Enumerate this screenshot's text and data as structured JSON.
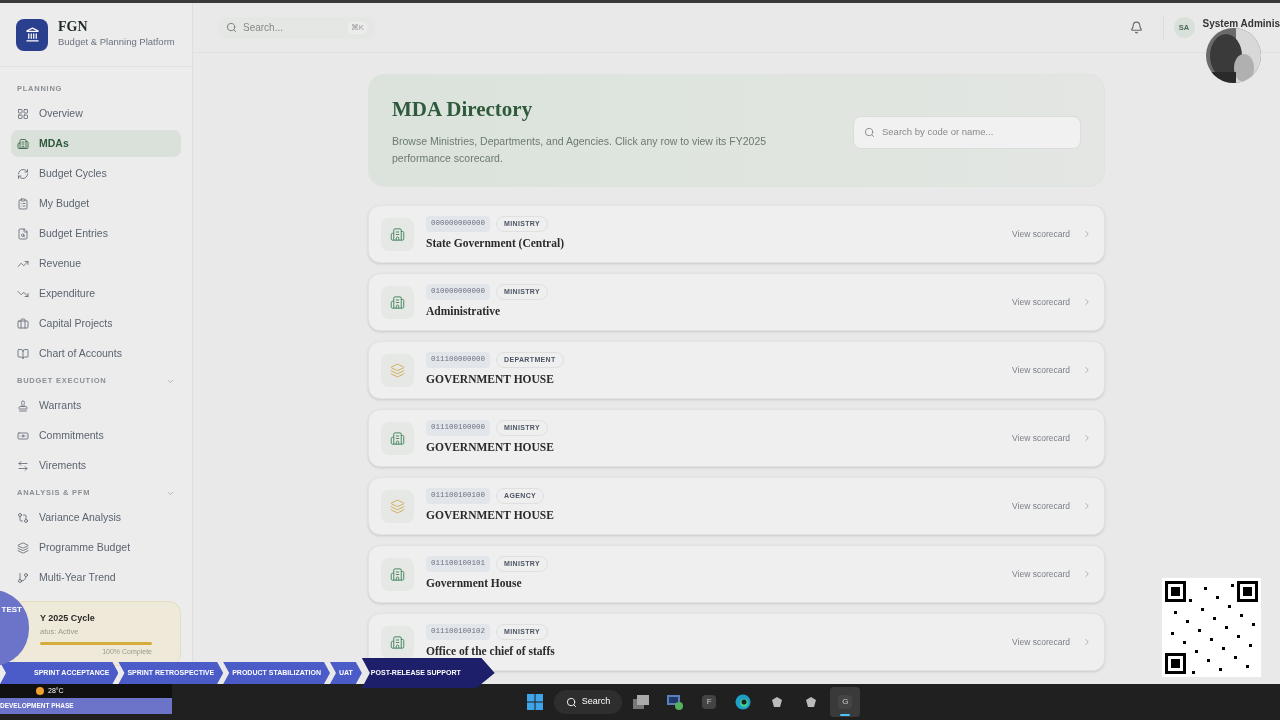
{
  "app": {
    "title": "FGN",
    "subtitle": "Budget & Planning Platform"
  },
  "sidebar": {
    "sections": [
      {
        "label": "PLANNING",
        "collapsible": false,
        "items": [
          {
            "label": "Overview",
            "selected": false
          },
          {
            "label": "MDAs",
            "selected": true
          },
          {
            "label": "Budget Cycles",
            "selected": false
          },
          {
            "label": "My Budget",
            "selected": false
          },
          {
            "label": "Budget Entries",
            "selected": false
          },
          {
            "label": "Revenue",
            "selected": false
          },
          {
            "label": "Expenditure",
            "selected": false
          },
          {
            "label": "Capital Projects",
            "selected": false
          },
          {
            "label": "Chart of Accounts",
            "selected": false
          }
        ]
      },
      {
        "label": "BUDGET EXECUTION",
        "collapsible": true,
        "items": [
          {
            "label": "Warrants",
            "selected": false
          },
          {
            "label": "Commitments",
            "selected": false
          },
          {
            "label": "Virements",
            "selected": false
          }
        ]
      },
      {
        "label": "ANALYSIS & PFM",
        "collapsible": true,
        "items": [
          {
            "label": "Variance Analysis",
            "selected": false
          },
          {
            "label": "Programme Budget",
            "selected": false
          },
          {
            "label": "Multi-Year Trend",
            "selected": false
          }
        ]
      }
    ],
    "cycle_card": {
      "title": "Y 2025 Cycle",
      "status": "atus: Active",
      "level": 1,
      "reading": "100% Complete"
    }
  },
  "header": {
    "search": {
      "placeholder": "Search...",
      "shortcut": "⌘K"
    },
    "user": {
      "initials": "SA",
      "name": "System Adminis"
    }
  },
  "directory": {
    "title": "MDA Directory",
    "description": "Browse Ministries, Departments, and Agencies. Click any row to view its FY2025 performance scorecard.",
    "search": {
      "placeholder": "Search by code or name..."
    },
    "rows": [
      {
        "code": "000000000000",
        "type": "MINISTRY",
        "name": "State Government (Central)",
        "kind": "building",
        "action": "View scorecard"
      },
      {
        "code": "010000000000",
        "type": "MINISTRY",
        "name": "Administrative",
        "kind": "building",
        "action": "View scorecard"
      },
      {
        "code": "011100000000",
        "type": "DEPARTMENT",
        "name": "GOVERNMENT HOUSE",
        "kind": "layers",
        "action": "View scorecard"
      },
      {
        "code": "011100100000",
        "type": "MINISTRY",
        "name": "GOVERNMENT HOUSE",
        "kind": "building",
        "action": "View scorecard"
      },
      {
        "code": "011100100100",
        "type": "AGENCY",
        "name": "GOVERNMENT HOUSE",
        "kind": "layers",
        "action": "View scorecard"
      },
      {
        "code": "011100100101",
        "type": "MINISTRY",
        "name": "Government House",
        "kind": "building",
        "action": "View scorecard"
      },
      {
        "code": "011100100102",
        "type": "MINISTRY",
        "name": "Office of the chief of staffs",
        "kind": "building",
        "action": "View scorecard"
      }
    ]
  },
  "overlay": {
    "timeline": [
      {
        "label": "SPRINT ACCEPTANCE",
        "selected": false
      },
      {
        "label": "SPRINT RETROSPECTIVE",
        "selected": false
      },
      {
        "label": "PRODUCT STABILIZATION",
        "selected": false
      },
      {
        "label": "UAT",
        "selected": false
      },
      {
        "label": "POST-RELEASE SUPPORT",
        "selected": true
      }
    ],
    "badge": "TEST",
    "weather": "28°C",
    "phase": "DEVELOPMENT PHASE"
  },
  "taskbar": {
    "items": [
      {
        "kind": "start",
        "selected": false
      },
      {
        "kind": "search",
        "label": "Search",
        "selected": false
      },
      {
        "kind": "files",
        "selected": false
      },
      {
        "kind": "remote",
        "selected": false
      },
      {
        "kind": "letter",
        "label": "F",
        "selected": false
      },
      {
        "kind": "edge",
        "selected": false
      },
      {
        "kind": "blob",
        "selected": false
      },
      {
        "kind": "blob",
        "selected": false
      },
      {
        "kind": "letter",
        "label": "G",
        "selected": true
      }
    ]
  }
}
